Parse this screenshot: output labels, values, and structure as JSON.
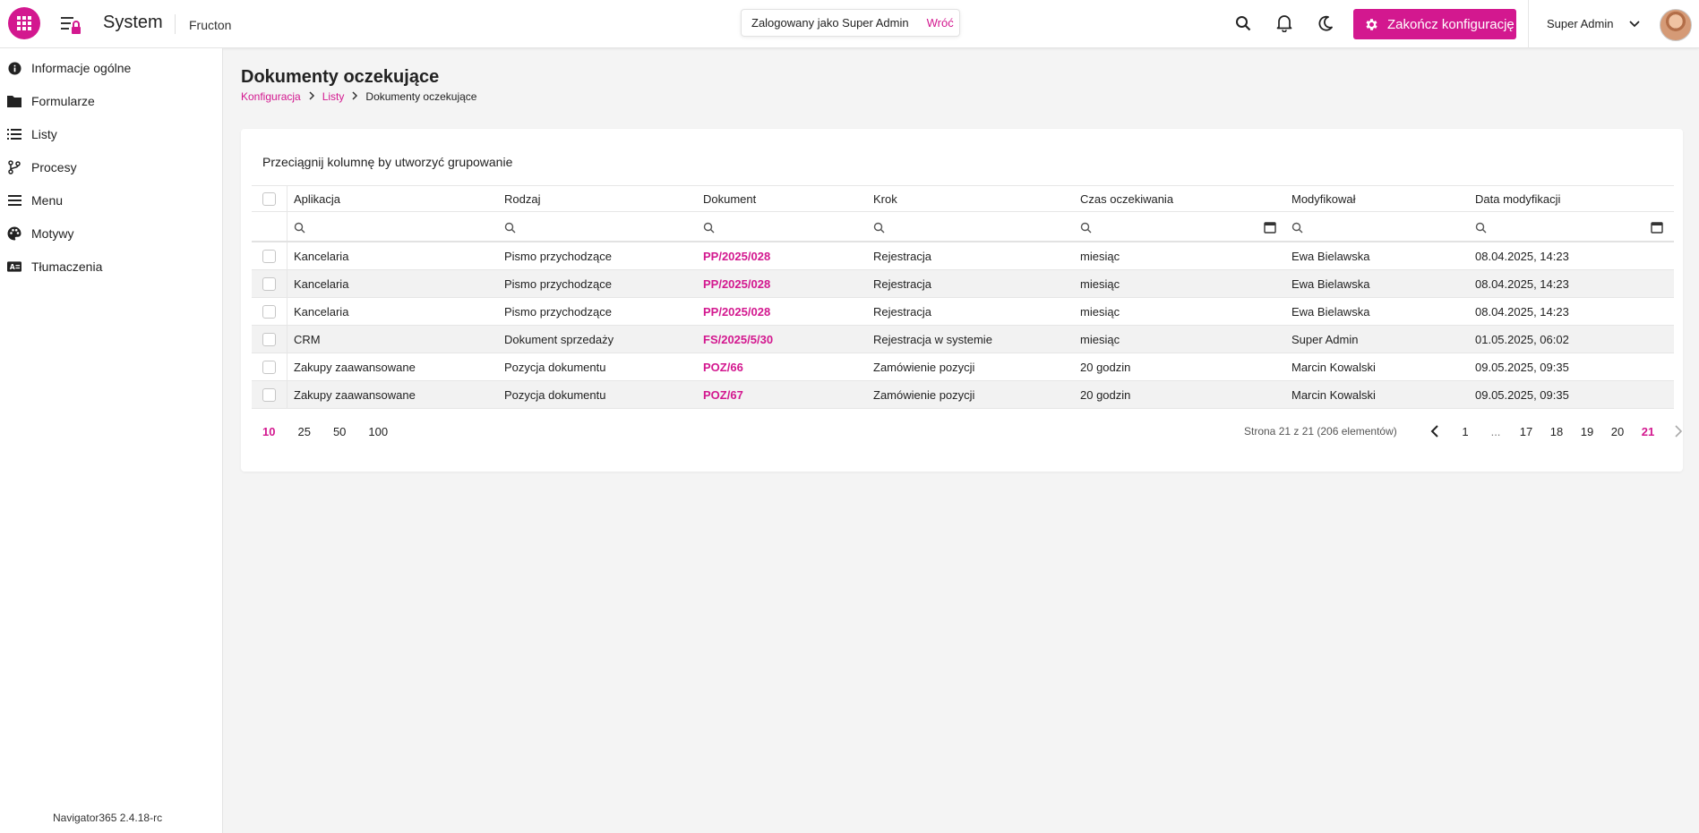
{
  "header": {
    "app_title": "System",
    "tenant": "Fructon",
    "login_text": "Zalogowany jako Super Admin",
    "back_label": "Wróć",
    "config_button": "Zakończ konfigurację",
    "user_name": "Super Admin"
  },
  "sidebar": {
    "items": [
      {
        "label": "Informacje ogólne",
        "icon": "info-icon"
      },
      {
        "label": "Formularze",
        "icon": "folder-icon"
      },
      {
        "label": "Listy",
        "icon": "list-icon"
      },
      {
        "label": "Procesy",
        "icon": "branch-icon"
      },
      {
        "label": "Menu",
        "icon": "menu-icon"
      },
      {
        "label": "Motywy",
        "icon": "palette-icon"
      },
      {
        "label": "Tłumaczenia",
        "icon": "translate-icon"
      }
    ],
    "version": "Navigator365 2.4.18-rc"
  },
  "page": {
    "title": "Dokumenty oczekujące",
    "breadcrumb": [
      "Konfiguracja",
      "Listy",
      "Dokumenty oczekujące"
    ]
  },
  "grid": {
    "group_hint": "Przeciągnij kolumnę by utworzyć grupowanie",
    "columns": [
      "Aplikacja",
      "Rodzaj",
      "Dokument",
      "Krok",
      "Czas oczekiwania",
      "Modyfikował",
      "Data modyfikacji"
    ],
    "rows": [
      [
        "Kancelaria",
        "Pismo przychodzące",
        "PP/2025/028",
        "Rejestracja",
        "miesiąc",
        "Ewa Bielawska",
        "08.04.2025, 14:23"
      ],
      [
        "Kancelaria",
        "Pismo przychodzące",
        "PP/2025/028",
        "Rejestracja",
        "miesiąc",
        "Ewa Bielawska",
        "08.04.2025, 14:23"
      ],
      [
        "Kancelaria",
        "Pismo przychodzące",
        "PP/2025/028",
        "Rejestracja",
        "miesiąc",
        "Ewa Bielawska",
        "08.04.2025, 14:23"
      ],
      [
        "CRM",
        "Dokument sprzedaży",
        "FS/2025/5/30",
        "Rejestracja w systemie",
        "miesiąc",
        "Super Admin",
        "01.05.2025, 06:02"
      ],
      [
        "Zakupy zaawansowane",
        "Pozycja dokumentu",
        "POZ/66",
        "Zamówienie pozycji",
        "20 godzin",
        "Marcin Kowalski",
        "09.05.2025, 09:35"
      ],
      [
        "Zakupy zaawansowane",
        "Pozycja dokumentu",
        "POZ/67",
        "Zamówienie pozycji",
        "20 godzin",
        "Marcin Kowalski",
        "09.05.2025, 09:35"
      ]
    ]
  },
  "pager": {
    "sizes": [
      "10",
      "25",
      "50",
      "100"
    ],
    "active_size": "10",
    "info": "Strona 21 z 21 (206 elementów)",
    "pages": [
      "1",
      "17",
      "18",
      "19",
      "20",
      "21"
    ],
    "ellipsis": "...",
    "active_page": "21"
  },
  "colors": {
    "accent": "#d3188f"
  }
}
